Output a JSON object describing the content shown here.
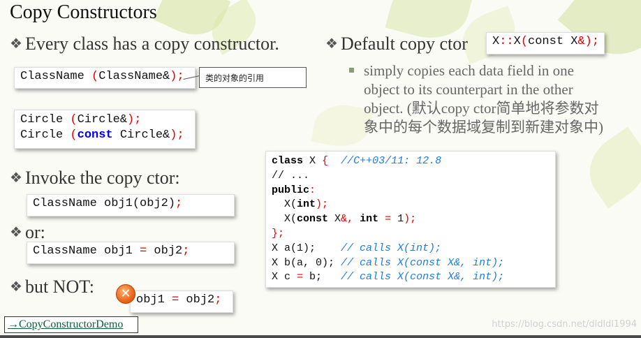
{
  "title": "Copy Constructors",
  "bullets": {
    "every_class": "Every class has a copy constructor.",
    "default_copy": "Default copy ctor",
    "invoke": "Invoke the copy ctor:",
    "or": "or:",
    "but_not": "but NOT:"
  },
  "callout": "类的对象的引用",
  "default_sub": {
    "line1": "simply copies each data field in one",
    "line2": "object to its counterpart in the other",
    "line3": "object. (默认copy ctor简单地将参数对",
    "line4": "象中的每个数据域复制到新建对象中)"
  },
  "demo_link": "→CopyConstructorDemo",
  "watermark": "https://blog.csdn.net/dldldl1994",
  "code": {
    "classname_sig": [
      "ClassName ",
      "(",
      "ClassName&",
      ");"
    ],
    "circle1": [
      "Circle ",
      "(",
      "Circle&",
      ");"
    ],
    "circle2": [
      "Circle ",
      "(",
      "const",
      " Circle&",
      ");"
    ],
    "obj1_paren": [
      "ClassName obj1(obj2)",
      ";"
    ],
    "obj1_assign": [
      "ClassName obj1 ",
      "=",
      " obj2",
      ";"
    ],
    "not_assign": [
      "obj1 ",
      "=",
      " obj2",
      ";"
    ],
    "default_sig": [
      "X",
      "::",
      "X",
      "(",
      "const X",
      "&",
      ");"
    ],
    "big": [
      [
        "class",
        " X ",
        "{",
        "  ",
        "//C++03/11: 12.8"
      ],
      [
        "// ..."
      ],
      [
        "public",
        ":"
      ],
      [
        "  X(",
        "int",
        ");"
      ],
      [
        "  X(",
        "const",
        " X",
        "&",
        ", ",
        "int",
        " ",
        "=",
        " 1",
        ");"
      ],
      [
        "};"
      ],
      [
        "X a(1);    ",
        "// calls X(int);"
      ],
      [
        "X b(a, 0); ",
        "// calls X(const X&, int);"
      ],
      [
        "X c ",
        "=",
        " b;   ",
        "// calls X(const X&, int);"
      ]
    ]
  },
  "colors": {
    "keyword_red": "#e00000",
    "comment_blue": "#1e7be0",
    "const_blue": "#0000ee",
    "link_green": "#0b5d3b"
  },
  "icons": {
    "bullet": "diamond-bullet-icon",
    "error": "error-x-icon"
  }
}
